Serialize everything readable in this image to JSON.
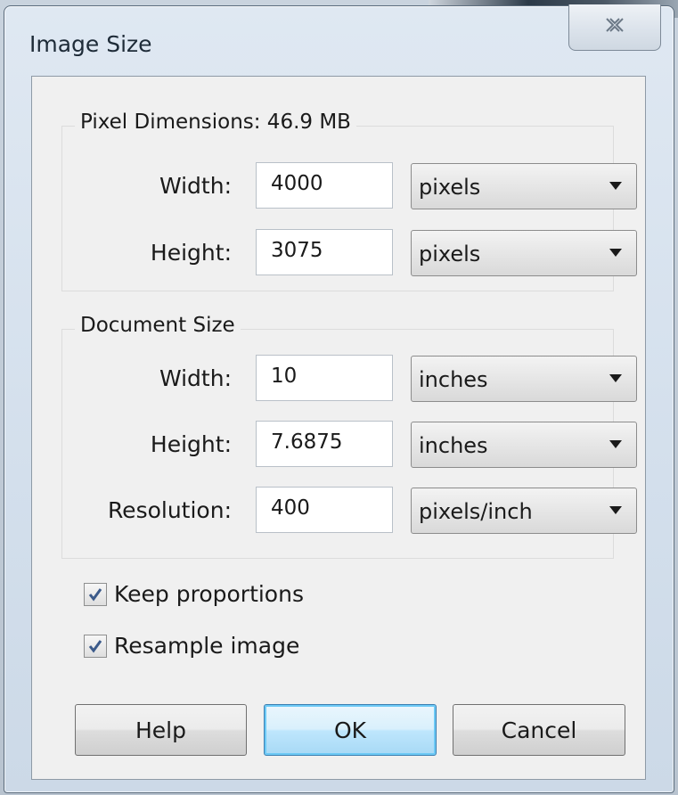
{
  "window": {
    "title": "Image Size",
    "close_icon": "close-x-icon"
  },
  "pixel_dimensions": {
    "legend": "Pixel Dimensions: 46.9 MB",
    "width": {
      "label": "Width:",
      "value": "4000",
      "unit": "pixels"
    },
    "height": {
      "label": "Height:",
      "value": "3075",
      "unit": "pixels"
    }
  },
  "document_size": {
    "legend": "Document Size",
    "width": {
      "label": "Width:",
      "value": "10",
      "unit": "inches"
    },
    "height": {
      "label": "Height:",
      "value": "7.6875",
      "unit": "inches"
    },
    "resolution": {
      "label": "Resolution:",
      "value": "400",
      "unit": "pixels/inch"
    }
  },
  "options": {
    "keep_proportions": {
      "label": "Keep proportions",
      "checked": true
    },
    "resample_image": {
      "label": "Resample image",
      "checked": true
    }
  },
  "buttons": {
    "help": "Help",
    "ok": "OK",
    "cancel": "Cancel"
  },
  "colors": {
    "checkmark": "#3b5a8a",
    "ok_border": "#3c7fb1"
  }
}
